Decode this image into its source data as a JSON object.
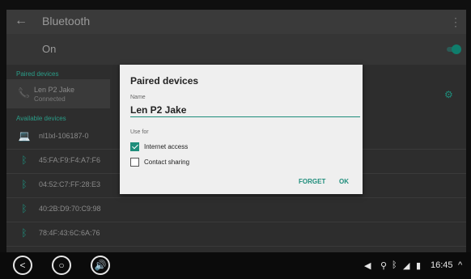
{
  "header": {
    "title": "Bluetooth",
    "back_icon": "back-arrow-icon",
    "more_icon": "more-vert-icon"
  },
  "toggle": {
    "label": "On",
    "checked": true
  },
  "sections": {
    "paired": "Paired devices",
    "available": "Available devices"
  },
  "paired_device": {
    "name": "Len P2 Jake",
    "status": "Connected"
  },
  "available_devices": [
    {
      "label": "nl1lxl-106187-0",
      "icon": "laptop-icon"
    },
    {
      "label": "45:FA:F9:F4:A7:F6",
      "icon": "bluetooth-icon"
    },
    {
      "label": "04:52:C7:FF:28:E3",
      "icon": "bluetooth-icon"
    },
    {
      "label": "40:2B:D9:70:C9:98",
      "icon": "bluetooth-icon"
    },
    {
      "label": "78:4F:43:6C:6A:76",
      "icon": "bluetooth-icon"
    }
  ],
  "dialog": {
    "title": "Paired devices",
    "name_label": "Name",
    "name_value": "Len P2 Jake",
    "use_for": "Use for",
    "options": [
      {
        "label": "Internet access",
        "checked": true
      },
      {
        "label": "Contact sharing",
        "checked": false
      }
    ],
    "forget": "FORGET",
    "ok": "OK"
  },
  "statusbar": {
    "time": "16:45"
  },
  "colors": {
    "accent": "#1e8d7b"
  }
}
